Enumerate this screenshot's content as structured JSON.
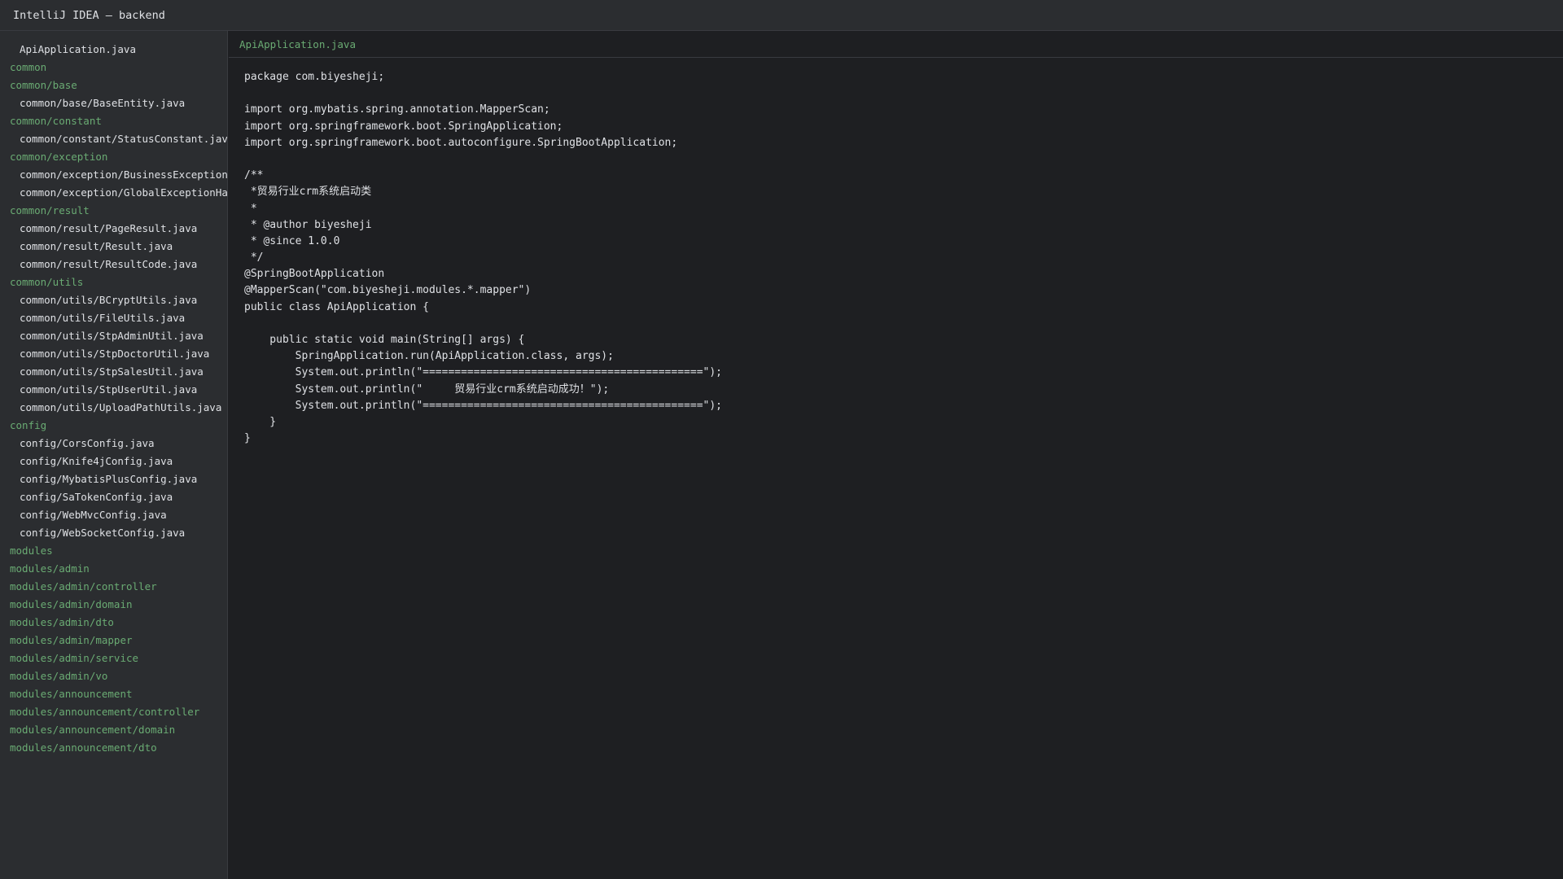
{
  "window": {
    "title": "IntelliJ IDEA — backend"
  },
  "tree": [
    {
      "label": "ApiApplication.java",
      "type": "file"
    },
    {
      "label": "common",
      "type": "folder"
    },
    {
      "label": "common/base",
      "type": "folder"
    },
    {
      "label": "common/base/BaseEntity.java",
      "type": "file"
    },
    {
      "label": "common/constant",
      "type": "folder"
    },
    {
      "label": "common/constant/StatusConstant.java",
      "type": "file"
    },
    {
      "label": "common/exception",
      "type": "folder"
    },
    {
      "label": "common/exception/BusinessException.java",
      "type": "file"
    },
    {
      "label": "common/exception/GlobalExceptionHandler.java",
      "type": "file"
    },
    {
      "label": "common/result",
      "type": "folder"
    },
    {
      "label": "common/result/PageResult.java",
      "type": "file"
    },
    {
      "label": "common/result/Result.java",
      "type": "file"
    },
    {
      "label": "common/result/ResultCode.java",
      "type": "file"
    },
    {
      "label": "common/utils",
      "type": "folder"
    },
    {
      "label": "common/utils/BCryptUtils.java",
      "type": "file"
    },
    {
      "label": "common/utils/FileUtils.java",
      "type": "file"
    },
    {
      "label": "common/utils/StpAdminUtil.java",
      "type": "file"
    },
    {
      "label": "common/utils/StpDoctorUtil.java",
      "type": "file"
    },
    {
      "label": "common/utils/StpSalesUtil.java",
      "type": "file"
    },
    {
      "label": "common/utils/StpUserUtil.java",
      "type": "file"
    },
    {
      "label": "common/utils/UploadPathUtils.java",
      "type": "file"
    },
    {
      "label": "config",
      "type": "folder"
    },
    {
      "label": "config/CorsConfig.java",
      "type": "file"
    },
    {
      "label": "config/Knife4jConfig.java",
      "type": "file"
    },
    {
      "label": "config/MybatisPlusConfig.java",
      "type": "file"
    },
    {
      "label": "config/SaTokenConfig.java",
      "type": "file"
    },
    {
      "label": "config/WebMvcConfig.java",
      "type": "file"
    },
    {
      "label": "config/WebSocketConfig.java",
      "type": "file"
    },
    {
      "label": "modules",
      "type": "folder"
    },
    {
      "label": "modules/admin",
      "type": "folder"
    },
    {
      "label": "modules/admin/controller",
      "type": "folder"
    },
    {
      "label": "modules/admin/domain",
      "type": "folder"
    },
    {
      "label": "modules/admin/dto",
      "type": "folder"
    },
    {
      "label": "modules/admin/mapper",
      "type": "folder"
    },
    {
      "label": "modules/admin/service",
      "type": "folder"
    },
    {
      "label": "modules/admin/vo",
      "type": "folder"
    },
    {
      "label": "modules/announcement",
      "type": "folder"
    },
    {
      "label": "modules/announcement/controller",
      "type": "folder"
    },
    {
      "label": "modules/announcement/domain",
      "type": "folder"
    },
    {
      "label": "modules/announcement/dto",
      "type": "folder"
    }
  ],
  "editor": {
    "tab": "ApiApplication.java",
    "lines": [
      "package com.biyesheji;",
      "",
      "import org.mybatis.spring.annotation.MapperScan;",
      "import org.springframework.boot.SpringApplication;",
      "import org.springframework.boot.autoconfigure.SpringBootApplication;",
      "",
      "/**",
      " *贸易行业crm系统启动类",
      " *",
      " * @author biyesheji",
      " * @since 1.0.0",
      " */",
      "@SpringBootApplication",
      "@MapperScan(\"com.biyesheji.modules.*.mapper\")",
      "public class ApiApplication {",
      "",
      "    public static void main(String[] args) {",
      "        SpringApplication.run(ApiApplication.class, args);",
      "        System.out.println(\"============================================\");",
      "        System.out.println(\"     贸易行业crm系统启动成功！\");",
      "        System.out.println(\"============================================\");",
      "    }",
      "}"
    ]
  }
}
